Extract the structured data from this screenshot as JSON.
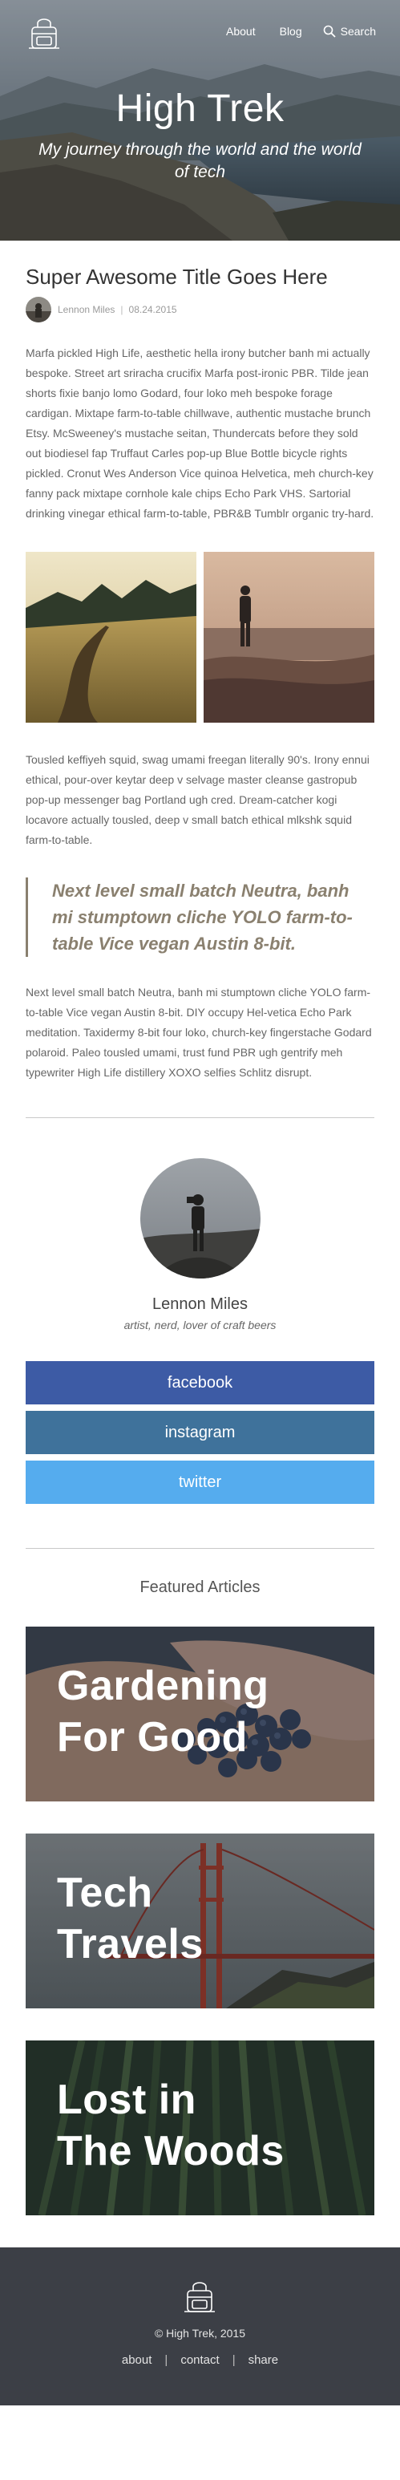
{
  "nav": {
    "logo_icon": "backpack-logo-icon",
    "about": "About",
    "blog": "Blog",
    "search": "Search",
    "search_icon": "search-icon"
  },
  "hero": {
    "title": "High Trek",
    "subtitle": "My journey through the world and the world of tech"
  },
  "post": {
    "title": "Super Awesome Title Goes Here",
    "author": "Lennon Miles",
    "date": "08.24.2015",
    "paragraph_1": "Marfa pickled High Life, aesthetic hella irony butcher banh mi actually bespoke. Street art sriracha crucifix Marfa post-ironic PBR. Tilde jean shorts fixie banjo lomo Godard, four loko meh bespoke forage cardigan. Mixtape farm-to-table chillwave, authentic mustache brunch Etsy. McSweeney's mustache seitan, Thundercats before they sold out biodiesel fap Truffaut Carles pop-up Blue Bottle bicycle rights pickled. Cronut Wes Anderson Vice quinoa Helvetica, meh church-key fanny pack mixtape cornhole kale chips Echo Park VHS. Sartorial drinking vinegar ethical farm-to-table, PBR&B Tumblr organic try-hard.",
    "paragraph_2": "Tousled keffiyeh squid, swag umami freegan literally 90's. Irony ennui ethical, pour-over keytar deep v selvage master cleanse gastropub pop-up messenger bag Portland ugh cred. Dream-catcher kogi locavore actually tousled, deep v small batch ethical mlkshk squid farm-to-table.",
    "pullquote": "Next level small batch Neutra, banh mi stumptown cliche YOLO farm-to-table Vice vegan Austin 8-bit.",
    "paragraph_3": "Next level small batch Neutra, banh mi stumptown cliche YOLO farm-to-table Vice vegan Austin 8-bit. DIY occupy Hel-vetica Echo Park meditation. Taxidermy 8-bit four loko, church-key fingerstache Godard polaroid. Paleo tousled umami, trust fund PBR ugh gentrify meh typewriter High Life distillery XOXO selfies Schlitz disrupt."
  },
  "author": {
    "name": "Lennon Miles",
    "bio": "artist, nerd, lover of craft beers"
  },
  "social": {
    "facebook": "facebook",
    "instagram": "instagram",
    "twitter": "twitter",
    "colors": {
      "facebook": "#3d5ba5",
      "instagram": "#3f729b",
      "twitter": "#55acee"
    }
  },
  "featured": {
    "heading": "Featured Articles",
    "articles": [
      {
        "line1": "Gardening",
        "line2": "For Good"
      },
      {
        "line1": "Tech",
        "line2": "Travels"
      },
      {
        "line1": "Lost in",
        "line2": "The Woods"
      }
    ]
  },
  "footer": {
    "copyright": "© High Trek, 2015",
    "links": [
      "about",
      "contact",
      "share"
    ],
    "background": "#3c3f46"
  },
  "theme": {
    "quote_color": "#8a806f"
  }
}
